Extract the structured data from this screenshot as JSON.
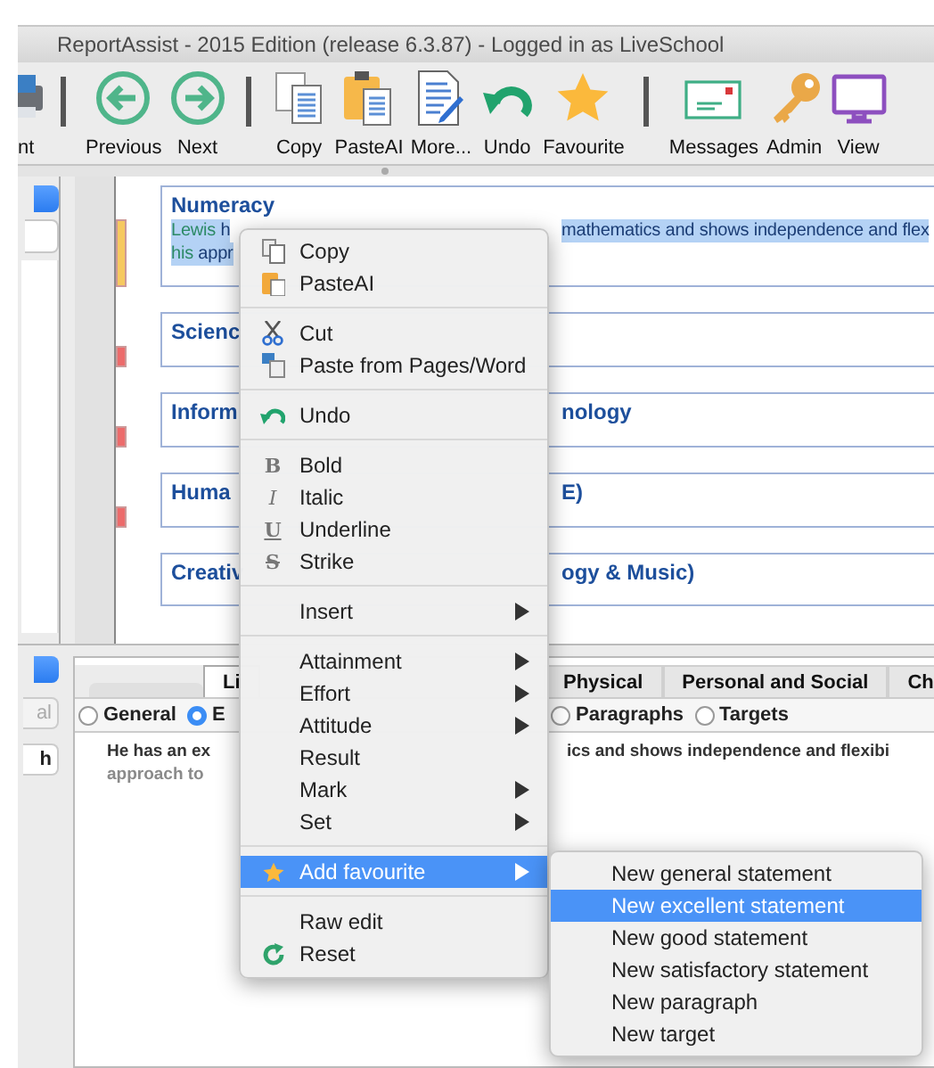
{
  "window": {
    "title": "ReportAssist - 2015 Edition (release 6.3.87) - Logged in as LiveSchool"
  },
  "toolbar": [
    [
      {
        "label": "nt",
        "kind": "printer"
      }
    ],
    [
      {
        "label": "Previous",
        "kind": "back"
      },
      {
        "label": "Next",
        "kind": "forward"
      }
    ],
    [
      {
        "label": "Copy",
        "kind": "copy"
      },
      {
        "label": "PasteAI",
        "kind": "paste"
      },
      {
        "label": "More...",
        "kind": "edit"
      },
      {
        "label": "Undo",
        "kind": "undo"
      },
      {
        "label": "Favourite",
        "kind": "star"
      }
    ],
    [
      {
        "label": "Messages",
        "kind": "message"
      },
      {
        "label": "Admin",
        "kind": "key"
      },
      {
        "label": "View",
        "kind": "monitor"
      }
    ]
  ],
  "cards": [
    {
      "title_left": "Numeracy",
      "color": "#f6c85f",
      "lines": [
        {
          "selected": true,
          "left": [
            {
              "text": "Lewis ",
              "kind": "name"
            },
            {
              "text": "h",
              "kind": "body"
            }
          ],
          "right": "mathematics and shows independence and flex"
        },
        {
          "selected": true,
          "left": [
            {
              "text": "his ",
              "kind": "name"
            },
            {
              "text": "appr",
              "kind": "body"
            }
          ]
        }
      ]
    },
    {
      "title_left": "Scienc",
      "color": "#ec6b6b"
    },
    {
      "title_left": "Inform",
      "title_right": "nology",
      "color": "#ec6b6b"
    },
    {
      "title_left": "Huma",
      "title_right": "E)",
      "color": "#ec6b6b"
    },
    {
      "title_left": "Creativ",
      "title_right": "ogy & Music)"
    }
  ],
  "sidebar_bottom": {
    "button": {
      "label": "al",
      "disabled": true
    },
    "field": {
      "value": "h"
    }
  },
  "tabs_left": [
    {
      "label": "Li",
      "selected": true
    }
  ],
  "tabs_right": [
    {
      "label": "Physical",
      "selected": false
    },
    {
      "label": "Personal and Social",
      "selected": false
    },
    {
      "label": "Ch",
      "selected": false
    }
  ],
  "radios_left": [
    {
      "label": "General",
      "selected": false
    },
    {
      "label": "E",
      "selected": true
    }
  ],
  "radios_right": [
    {
      "label": "Paragraphs",
      "selected": false
    },
    {
      "label": "Targets",
      "selected": false
    }
  ],
  "statement": [
    {
      "left": "He has an ex",
      "right": "ics and shows independence and flexibi",
      "faded": false
    },
    {
      "left": "approach to",
      "faded": true
    }
  ],
  "context_menu": {
    "groups": [
      {
        "items": [
          {
            "label": "Copy",
            "kind": "copy",
            "selected": false
          },
          {
            "label": "PasteAI",
            "kind": "paste",
            "selected": false
          }
        ]
      },
      {
        "items": [
          {
            "label": "Cut",
            "kind": "cut",
            "selected": false
          },
          {
            "label": "Paste from Pages/Word",
            "kind": "import",
            "selected": false
          }
        ]
      },
      {
        "items": [
          {
            "label": "Undo",
            "kind": "undo",
            "selected": false
          }
        ]
      },
      {
        "items": [
          {
            "label": "Bold",
            "glyph": "B",
            "kind": "bold",
            "selected": false
          },
          {
            "label": "Italic",
            "glyph": "I",
            "kind": "italic",
            "selected": false
          },
          {
            "label": "Underline",
            "glyph": "U",
            "kind": "underline",
            "selected": false
          },
          {
            "label": "Strike",
            "glyph": "S",
            "kind": "strike",
            "selected": false
          }
        ]
      },
      {
        "items": [
          {
            "label": "Insert",
            "submenu": true,
            "selected": false
          }
        ]
      },
      {
        "items": [
          {
            "label": "Attainment",
            "submenu": true,
            "selected": false
          },
          {
            "label": "Effort",
            "submenu": true,
            "selected": false
          },
          {
            "label": "Attitude",
            "submenu": true,
            "selected": false
          },
          {
            "label": "Result",
            "selected": false
          },
          {
            "label": "Mark",
            "submenu": true,
            "selected": false
          },
          {
            "label": "Set",
            "submenu": true,
            "selected": false
          }
        ]
      },
      {
        "items": [
          {
            "label": "Add favourite",
            "kind": "star",
            "submenu": true,
            "selected": true
          }
        ]
      },
      {
        "items": [
          {
            "label": "Raw edit",
            "selected": false
          },
          {
            "label": "Reset",
            "kind": "reset",
            "selected": false
          }
        ]
      }
    ]
  },
  "submenu": [
    {
      "label": "New general statement",
      "selected": false
    },
    {
      "label": "New excellent statement",
      "selected": true
    },
    {
      "label": "New good statement",
      "selected": false
    },
    {
      "label": "New satisfactory statement",
      "selected": false
    },
    {
      "label": "New paragraph",
      "selected": false
    },
    {
      "label": "New target",
      "selected": false
    }
  ]
}
